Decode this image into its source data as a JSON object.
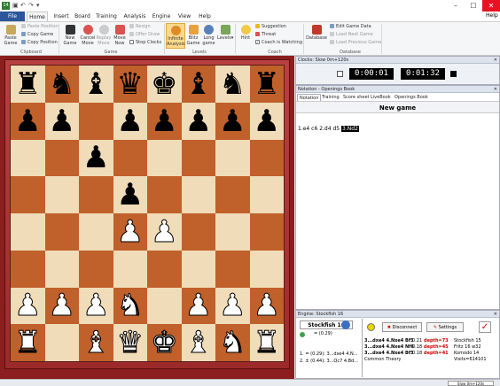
{
  "titlebar": {
    "app_icon_text": "14",
    "minimize": "–",
    "maximize": "☐",
    "close": "✕"
  },
  "menu": {
    "tabs": [
      "File",
      "Home",
      "Insert",
      "Board",
      "Training",
      "Analysis",
      "Engine",
      "View",
      "Help"
    ],
    "help_link": "Help"
  },
  "ribbon": {
    "paste_game": "Paste Game",
    "paste_position": "Paste Position",
    "copy_game": "Copy Game",
    "copy_position": "Copy Position",
    "clipboard_group": "Clipboard",
    "new_game": "New Game",
    "cancel_move": "Cancel Move",
    "replay_move": "Replay Move",
    "move_now": "Move Now",
    "resign": "Resign",
    "offer_draw": "Offer Draw",
    "stop_clocks": "Stop Clocks",
    "game_group": "Game",
    "infinite_analysis": "Infinite Analysis",
    "blitz_game": "Blitz Game",
    "long_game": "Long game",
    "levels": "Levels",
    "levels_group": "Levels",
    "hint": "Hint",
    "suggestion": "Suggestion",
    "threat": "Threat",
    "coach_watching": "Coach is Watching",
    "coach_group": "Coach",
    "database": "Database",
    "edit_game_data": "Edit Game Data",
    "load_next_game": "Load Next Game",
    "load_previous_game": "Load Previous Game",
    "database_group": "Database"
  },
  "board": {
    "ranks": [
      [
        "br",
        "bn",
        "bb",
        "bq",
        "bk",
        "bb",
        "bn",
        "br"
      ],
      [
        "bp",
        "bp",
        "",
        "bp",
        "bp",
        "bp",
        "bp",
        "bp"
      ],
      [
        "",
        "",
        "bp",
        "",
        "",
        "",
        "",
        ""
      ],
      [
        "",
        "",
        "",
        "bp",
        "",
        "",
        "",
        ""
      ],
      [
        "",
        "",
        "",
        "wp",
        "wp",
        "",
        "",
        ""
      ],
      [
        "",
        "",
        "",
        "",
        "",
        "",
        "",
        ""
      ],
      [
        "wp",
        "wp",
        "wp",
        "wn",
        "",
        "wp",
        "wp",
        "wp"
      ],
      [
        "wr",
        "",
        "wb",
        "wq",
        "wk",
        "wb",
        "wn",
        "wr"
      ]
    ]
  },
  "clocks": {
    "header": "Clocks: Slow 0m+120s",
    "white_time": "0:00:01",
    "black_time": "0:01:32"
  },
  "notation": {
    "header": "Notation - Openings Book",
    "tabs": [
      "Notation",
      "Training",
      "Score sheet",
      "LiveBook",
      "Openings Book"
    ],
    "title": "New game",
    "moves": [
      "1.e4",
      "c6",
      "2.d4",
      "d5"
    ],
    "current_move": "3.Nd2"
  },
  "engine": {
    "header": "Engine: Stockfish 16",
    "engine_name": "Stockfish 16",
    "eval": "= (0.29)",
    "disconnect": "Disconnect",
    "settings": "Settings",
    "lines": [
      "1. = (0.29): 3...dxe4 4.N...",
      "2. ± (0.44): 3...Qc7 4.Bd..."
    ],
    "book_rows": [
      {
        "move": "3...dxe4 4.Nxe4 Bf5",
        "score": "0.21",
        "depth": "depth=73",
        "engine": "Stockfish 15"
      },
      {
        "move": "3...dxe4 4.Nxe4 Nf6",
        "score": "0.18",
        "depth": "depth=45",
        "engine": "Fritz 16 w32"
      },
      {
        "move": "3...dxe4 4.Nxe4 Bf5",
        "score": "0.18",
        "depth": "depth=41",
        "engine": "Komodo 14"
      }
    ],
    "common_theory": "Common Theory",
    "visits": "Visits=614101"
  },
  "statusbar": {
    "right_text": "Slow 0m+120s"
  },
  "colors": {
    "accent": "#2b579a",
    "board_light": "#f0dcb8",
    "board_dark": "#c0602a",
    "frame": "#8b1e1e"
  }
}
